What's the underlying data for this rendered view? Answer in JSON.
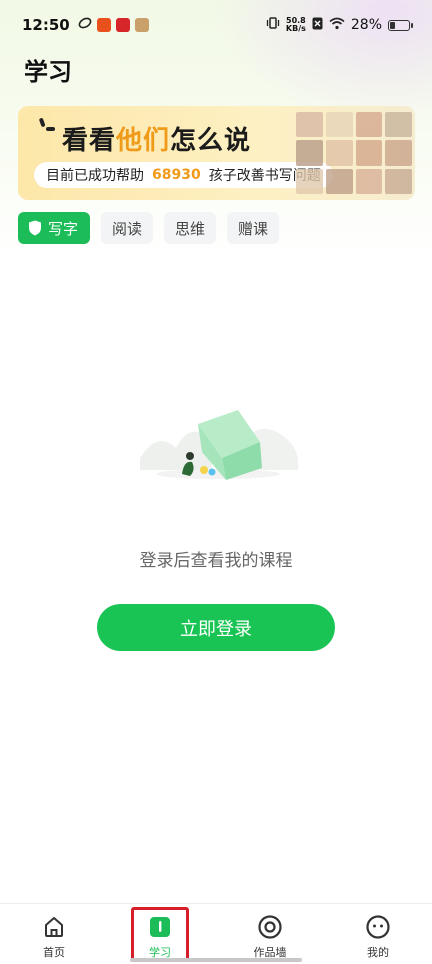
{
  "status_bar": {
    "time": "12:50",
    "net_speed_value": "50.8",
    "net_speed_unit": "KB/s",
    "battery": "28%",
    "battery_level": 0.28
  },
  "page": {
    "title": "学习"
  },
  "banner": {
    "headline_prefix": "看看",
    "headline_highlight": "他们",
    "headline_suffix": "怎么说",
    "sub_prefix": "目前已成功帮助",
    "sub_number": "68930",
    "sub_suffix": "孩子改善书写问题"
  },
  "tabs": [
    {
      "label": "写字",
      "active": true
    },
    {
      "label": "阅读",
      "active": false
    },
    {
      "label": "思维",
      "active": false
    },
    {
      "label": "赠课",
      "active": false
    }
  ],
  "empty_state": {
    "message": "登录后查看我的课程",
    "button_label": "立即登录"
  },
  "bottom_nav": [
    {
      "label": "首页",
      "icon": "home-icon",
      "active": false
    },
    {
      "label": "学习",
      "icon": "study-book-icon",
      "active": true
    },
    {
      "label": "作品墙",
      "icon": "gallery-ring-icon",
      "active": false
    },
    {
      "label": "我的",
      "icon": "face-profile-icon",
      "active": false
    }
  ],
  "colors": {
    "accent_green": "#1cbd58",
    "highlight_orange": "#f09a1a",
    "annotation_red": "#d81d2a"
  }
}
